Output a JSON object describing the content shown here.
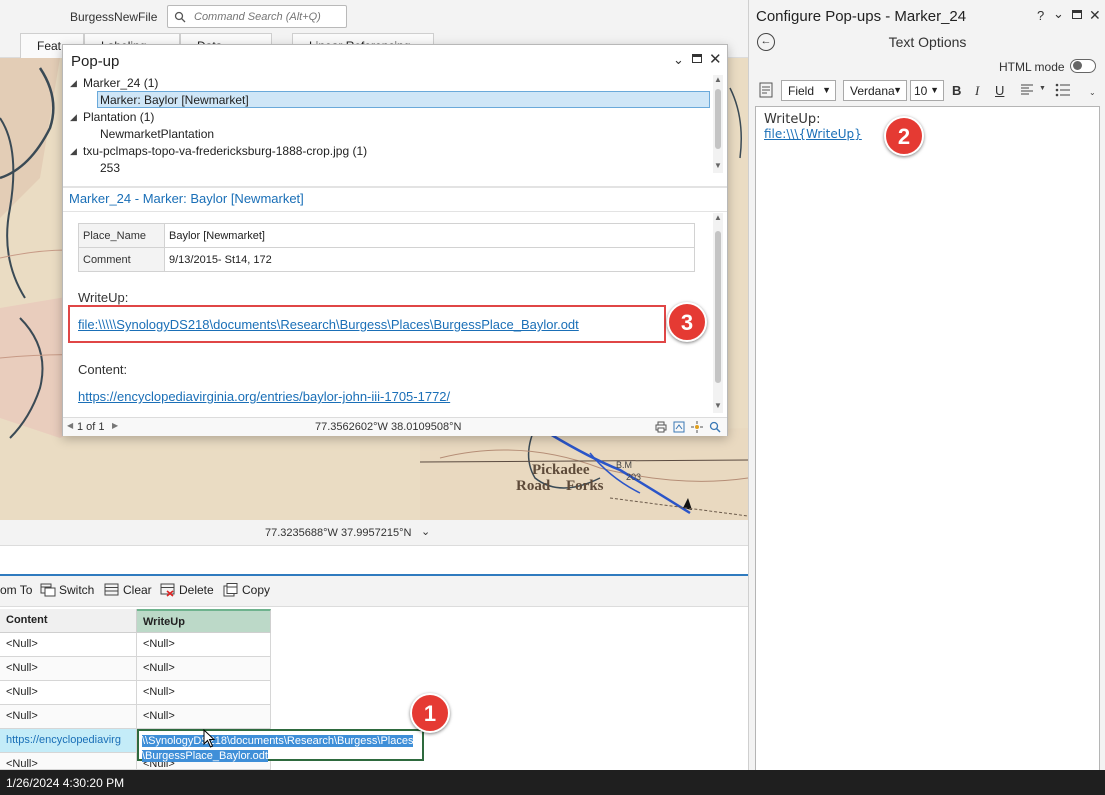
{
  "app": {
    "file_name": "BurgessNewFile",
    "search_placeholder": "Command Search (Alt+Q)",
    "ribbon_tabs": [
      "Feat",
      "Labeling",
      "Data",
      "Linear Referencing"
    ]
  },
  "map": {
    "labels": [
      "Pickadee",
      "Road",
      "Forks",
      "B.M",
      "203"
    ],
    "coords": "77.3235688°W 37.9957215°N"
  },
  "popup": {
    "title": "Pop-up",
    "tree": [
      {
        "label": "Marker_24 (1)",
        "child": "Marker: Baylor [Newmarket]"
      },
      {
        "label": "Plantation (1)",
        "child": "NewmarketPlantation"
      },
      {
        "label": "txu-pclmaps-topo-va-fredericksburg-1888-crop.jpg (1)",
        "child": "253"
      }
    ],
    "header": "Marker_24 - Marker: Baylor [Newmarket]",
    "fields": [
      {
        "key": "Place_Name",
        "value": "Baylor [Newmarket]"
      },
      {
        "key": "Comment",
        "value": "9/13/2015- St14, 172"
      }
    ],
    "writeup_label": "WriteUp:",
    "writeup_link": "file:\\\\\\\\\\SynologyDS218\\documents\\Research\\Burgess\\Places\\BurgessPlace_Baylor.odt",
    "content_label": "Content:",
    "content_link": "https://encyclopediavirginia.org/entries/baylor-john-iii-1705-1772/",
    "page_indicator": "1 of 1",
    "coords": "77.3562602°W 38.0109508°N"
  },
  "config": {
    "title": "Configure Pop-ups - Marker_24",
    "subtitle": "Text Options",
    "html_mode_label": "HTML mode",
    "html_mode_on": false,
    "field_select": "Field",
    "font_select": "Verdana",
    "size_select": "10",
    "bold": "B",
    "italic": "I",
    "underline": "U",
    "editor_label": "WriteUp:",
    "editor_link": "file:\\\\\\{WriteUp}"
  },
  "table": {
    "toolbar": [
      "om To",
      "Switch",
      "Clear",
      "Delete",
      "Copy"
    ],
    "columns": [
      "Content",
      "WriteUp"
    ],
    "rows": [
      [
        "<Null>",
        "<Null>"
      ],
      [
        "<Null>",
        "<Null>"
      ],
      [
        "<Null>",
        "<Null>"
      ],
      [
        "<Null>",
        "<Null>"
      ],
      [
        "https://encyclopediavirg",
        ""
      ],
      [
        "<Null>",
        "<Null>"
      ]
    ],
    "edit_value_line1": "\\\\SynologyDS218\\documents\\Research\\Burgess\\Places",
    "edit_value_line2": "\\BurgessPlace_Baylor.odt"
  },
  "status": {
    "timestamp": "1/26/2024 4:30:20 PM"
  },
  "callouts": [
    "1",
    "2",
    "3"
  ],
  "colors": {
    "accent": "#2f7bbf",
    "link": "#1a6fb7",
    "callout": "#e53a33",
    "highlight_border": "#e04646",
    "selected_row": "#c4ecf8"
  }
}
